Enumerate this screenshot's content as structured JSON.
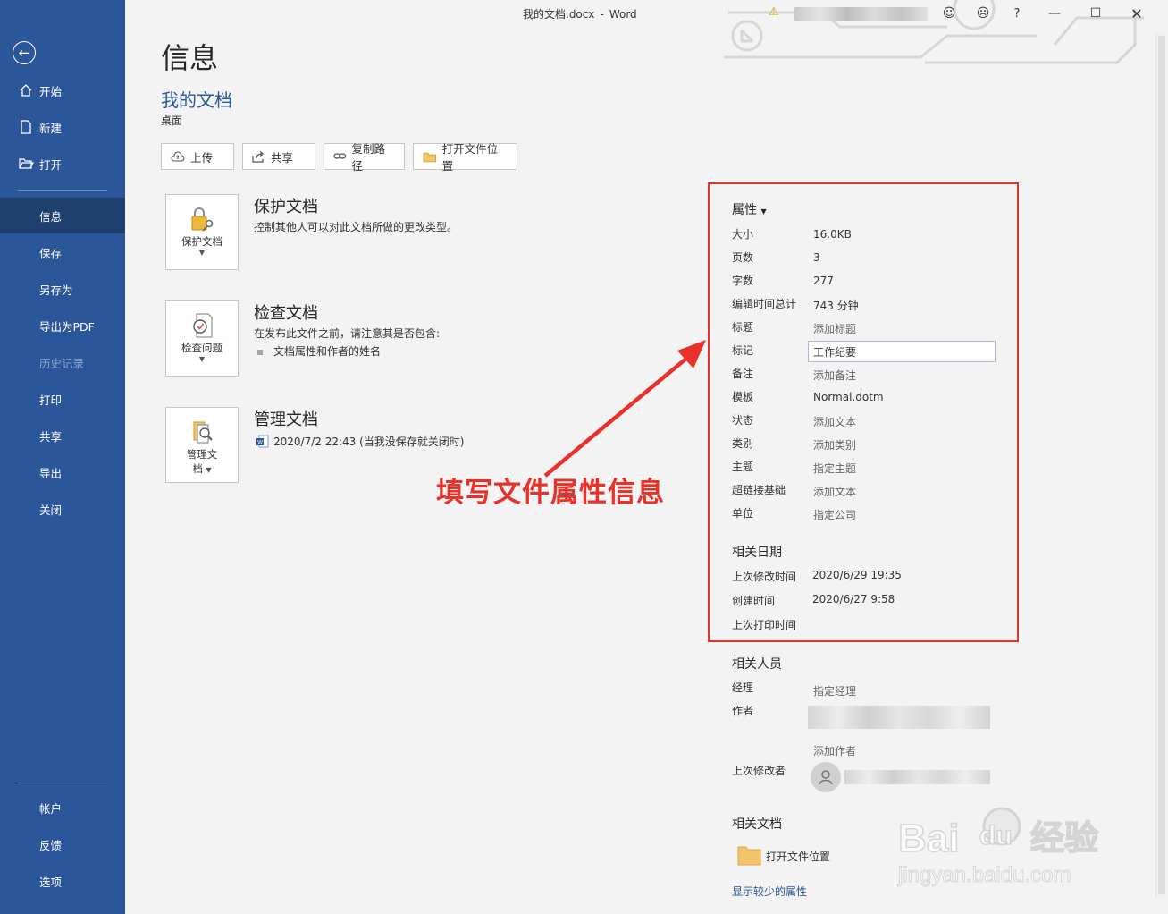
{
  "titlebar": {
    "doc": "我的文档.docx",
    "separator": "-",
    "app": "Word"
  },
  "sidebar": {
    "items": [
      {
        "label": "开始",
        "icon": "home-icon"
      },
      {
        "label": "新建",
        "icon": "new-doc-icon"
      },
      {
        "label": "打开",
        "icon": "folder-open-icon"
      },
      {
        "label": "信息"
      },
      {
        "label": "保存"
      },
      {
        "label": "另存为"
      },
      {
        "label": "导出为PDF"
      },
      {
        "label": "历史记录"
      },
      {
        "label": "打印"
      },
      {
        "label": "共享"
      },
      {
        "label": "导出"
      },
      {
        "label": "关闭"
      },
      {
        "label": "帐户"
      },
      {
        "label": "反馈"
      },
      {
        "label": "选项"
      }
    ]
  },
  "main": {
    "title": "信息",
    "doc_name": "我的文档",
    "doc_location": "桌面",
    "actions": [
      "上传",
      "共享",
      "复制路径",
      "打开文件位置"
    ],
    "protect": {
      "button": "保护文档",
      "title": "保护文档",
      "desc": "控制其他人可以对此文档所做的更改类型。"
    },
    "inspect": {
      "button": "检查问题",
      "title": "检查文档",
      "desc": "在发布此文件之前，请注意其是否包含:",
      "bullet": "文档属性和作者的姓名"
    },
    "manage": {
      "button_line1": "管理文",
      "button_line2": "档",
      "title": "管理文档",
      "entry": "2020/7/2 22:43 (当我没保存就关闭时)"
    }
  },
  "annotation": "填写文件属性信息",
  "properties": {
    "header": "属性",
    "rows": [
      {
        "label": "大小",
        "value": "16.0KB"
      },
      {
        "label": "页数",
        "value": "3"
      },
      {
        "label": "字数",
        "value": "277"
      },
      {
        "label": "编辑时间总计",
        "value": "743 分钟"
      },
      {
        "label": "标题",
        "value": "添加标题"
      },
      {
        "label": "标记",
        "value": "工作纪要"
      },
      {
        "label": "备注",
        "value": "添加备注"
      },
      {
        "label": "模板",
        "value": "Normal.dotm"
      },
      {
        "label": "状态",
        "value": "添加文本"
      },
      {
        "label": "类别",
        "value": "添加类别"
      },
      {
        "label": "主题",
        "value": "指定主题"
      },
      {
        "label": "超链接基础",
        "value": "添加文本"
      },
      {
        "label": "单位",
        "value": "指定公司"
      }
    ]
  },
  "dates": {
    "header": "相关日期",
    "rows": [
      {
        "label": "上次修改时间",
        "value": "2020/6/29 19:35"
      },
      {
        "label": "创建时间",
        "value": "2020/6/27 9:58"
      },
      {
        "label": "上次打印时间",
        "value": ""
      }
    ]
  },
  "people": {
    "header": "相关人员",
    "manager_label": "经理",
    "manager_value": "指定经理",
    "author_label": "作者",
    "add_author": "添加作者",
    "last_modified_label": "上次修改者"
  },
  "related_docs": {
    "header": "相关文档",
    "open_location": "打开文件位置"
  },
  "show_less": "显示较少的属性",
  "watermark": {
    "brand": "Bai",
    "brand2": "du",
    "cn": "经验",
    "url": "jingyan.baidu.com"
  },
  "colors": {
    "sidebar": "#2b579a",
    "accent": "#2b579a",
    "annotation": "#e8312a"
  }
}
